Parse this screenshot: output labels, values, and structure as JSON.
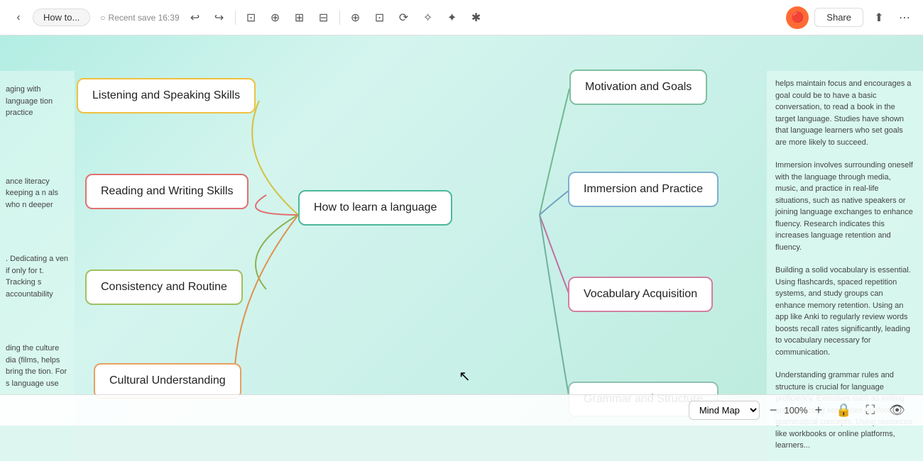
{
  "toolbar": {
    "back_icon": "‹",
    "tab_title": "How to...",
    "save_label": "Recent save 16:39",
    "undo_icon": "↩",
    "redo_icon": "↪",
    "share_label": "Share",
    "export_icon": "⬆",
    "more_icon": "⋯"
  },
  "nodes": {
    "central": "How to learn a language",
    "left": {
      "listening": "Listening and Speaking Skills",
      "reading": "Reading and Writing Skills",
      "consistency": "Consistency and Routine",
      "cultural": "Cultural Understanding"
    },
    "right": {
      "motivation": "Motivation and Goals",
      "immersion": "Immersion and Practice",
      "vocabulary": "Vocabulary Acquisition",
      "grammar": "Grammar and Structure"
    }
  },
  "notes": {
    "motivation": "helps maintain focus and encourages a goal could be to have a basic conversation, to read a book in the target language. Studies have shown that language learners who set goals are more likely to succeed.",
    "immersion": "Immersion involves surrounding oneself with the language through media, music, and practice in real-life situations, such as native speakers or joining language exchanges to enhance fluency. Research indicates this increases language retention and fluency.",
    "vocabulary": "Building a solid vocabulary is essential. Using flashcards, spaced repetition systems, and study groups can enhance memory retention. Using an app like Anki to regularly review words boosts recall rates significantly, leading to vocabulary necessary for communication.",
    "grammar": "Understanding grammar rules and structure is crucial for language proficiency. Exercises such as writing and correcting sentences reinforce grammatical concepts. Using resources like workbooks or online platforms, learners..."
  },
  "left_notes": {
    "listening": "aging with\nlanguage\ntion\npractice",
    "reading": "ance literacy\nkeeping a\nn\nals who\nn deeper",
    "consistency": ". Dedicating a\nven if only for\nt. Tracking\ns accountability",
    "cultural": "ding the culture\ndia (films,\nhelps bring the\ntion. For\ns language use"
  },
  "bottom": {
    "mindmap_label": "Mind Map",
    "zoom_minus": "−",
    "zoom_value": "100%",
    "zoom_plus": "+"
  }
}
